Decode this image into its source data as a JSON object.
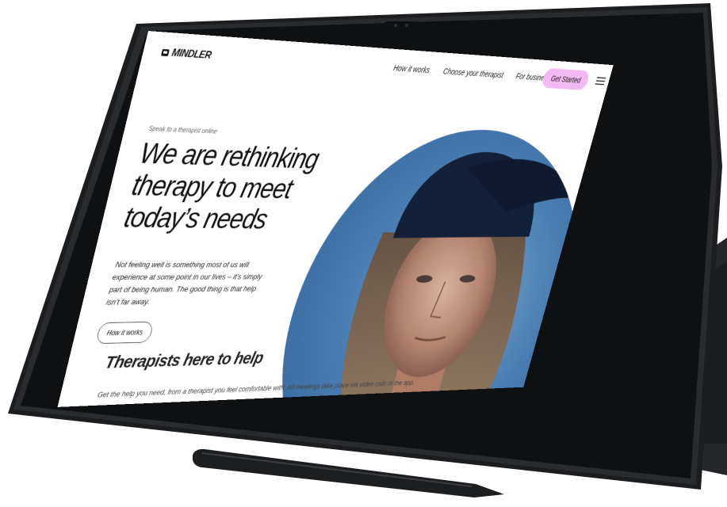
{
  "nav": {
    "logo": "MINDLER",
    "links": [
      "How it works",
      "Choose your therapist",
      "For businesses"
    ],
    "cta": "Get Started",
    "menu_icon": "hamburger-icon"
  },
  "hero": {
    "eyebrow": "Speak to a therapist online",
    "headline": "We are rethinking therapy to meet today’s needs",
    "lead": "Not feeling well is something most of us will experience at some point in our lives – it’s simply part of being human. The good thing is that help isn’t far away.",
    "button": "How it works",
    "image": "portrait-photo"
  },
  "section": {
    "title": "Therapists here to help",
    "subtitle": "Get the help you need, from a therapist you feel comfortable with. All meetings take place via video calls in the app."
  },
  "colors": {
    "accent": "#f4b8f3",
    "device": "#1e1f21",
    "photo_bg": "#4a7eb2"
  }
}
